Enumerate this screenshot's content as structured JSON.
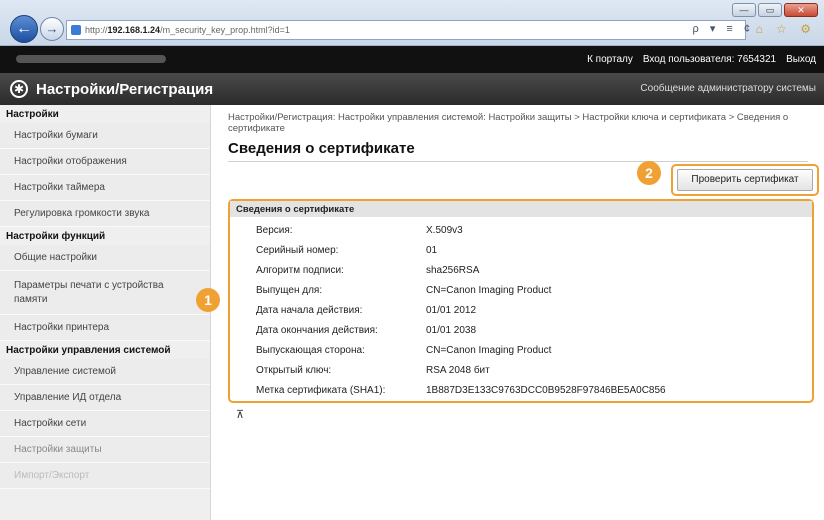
{
  "browser": {
    "url_prefix": "http://",
    "url_host": "192.168.1.24",
    "url_path": "/m_security_key_prop.html?id=1",
    "search_controls": "ρ ▾ ≡ ¢",
    "toolbar_icons": "⌂ ☆ ⚙"
  },
  "top_bar": {
    "portal_link": "К порталу",
    "user_info": "Вход пользователя: 7654321",
    "logout_link": "Выход"
  },
  "title_bar": {
    "app_title": "Настройки/Регистрация",
    "admin_message": "Сообщение администратору системы"
  },
  "sidebar": {
    "section1_title": "Настройки",
    "section1_items": [
      "Настройки бумаги",
      "Настройки отображения",
      "Настройки таймера",
      "Регулировка громкости звука"
    ],
    "section2_title": "Настройки функций",
    "section2_items": [
      "Общие настройки",
      "Параметры печати с устройства памяти",
      "Настройки принтера"
    ],
    "section3_title": "Настройки управления системой",
    "section3_items": [
      "Управление системой",
      "Управление ИД отдела",
      "Настройки сети",
      "Настройки защиты",
      "Импорт/Экспорт"
    ]
  },
  "main": {
    "breadcrumb": "Настройки/Регистрация: Настройки управления системой: Настройки защиты > Настройки ключа и сертификата > Сведения о сертификате",
    "page_title": "Сведения о сертификате",
    "check_button": "Проверить сертификат",
    "info_header": "Сведения о сертификате",
    "rows": [
      {
        "label": "Версия:",
        "value": "X.509v3"
      },
      {
        "label": "Серийный номер:",
        "value": "01"
      },
      {
        "label": "Алгоритм подписи:",
        "value": "sha256RSA"
      },
      {
        "label": "Выпущен для:",
        "value": "CN=Canon Imaging Product"
      },
      {
        "label": "Дата начала действия:",
        "value": "01/01 2012"
      },
      {
        "label": "Дата окончания действия:",
        "value": "01/01 2038"
      },
      {
        "label": "Выпускающая сторона:",
        "value": "CN=Canon Imaging Product"
      },
      {
        "label": "Открытый ключ:",
        "value": "RSA 2048 бит"
      },
      {
        "label": "Метка сертификата (SHA1):",
        "value": "1B887D3E133C9763DCC0B9528F97846BE5A0C856"
      }
    ],
    "marker1": "1",
    "marker2": "2",
    "top_icon": "⊼"
  },
  "colors": {
    "highlight": "#f0a133"
  }
}
